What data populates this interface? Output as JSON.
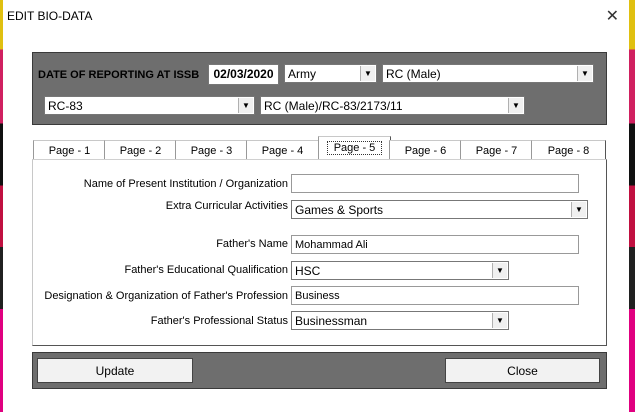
{
  "window": {
    "title": "EDIT BIO-DATA",
    "close_glyph": "✕"
  },
  "header": {
    "date_label": "DATE OF REPORTING AT ISSB",
    "date_value": "02/03/2020",
    "service": "Army",
    "category": "RC (Male)",
    "board": "RC-83",
    "reference": "RC (Male)/RC-83/2173/11"
  },
  "tabs": [
    "Page - 1",
    "Page - 2",
    "Page - 3",
    "Page - 4",
    "Page - 5",
    "Page - 6",
    "Page - 7",
    "Page - 8"
  ],
  "active_tab": "Page - 5",
  "form": {
    "institution_label": "Name of Present Institution / Organization",
    "institution_value": "",
    "extra_label": "Extra Curricular Activities",
    "extra_value": "Games & Sports",
    "father_name_label": "Father's Name",
    "father_name_value": "Mohammad Ali",
    "father_edu_label": "Father's Educational Qualification",
    "father_edu_value": "HSC",
    "father_prof_label": "Designation & Organization of Father's Profession",
    "father_prof_value": "Business",
    "father_status_label": "Father's Professional Status",
    "father_status_value": "Businessman"
  },
  "buttons": {
    "update": "Update",
    "close": "Close"
  },
  "icons": {
    "dropdown": "▼"
  }
}
